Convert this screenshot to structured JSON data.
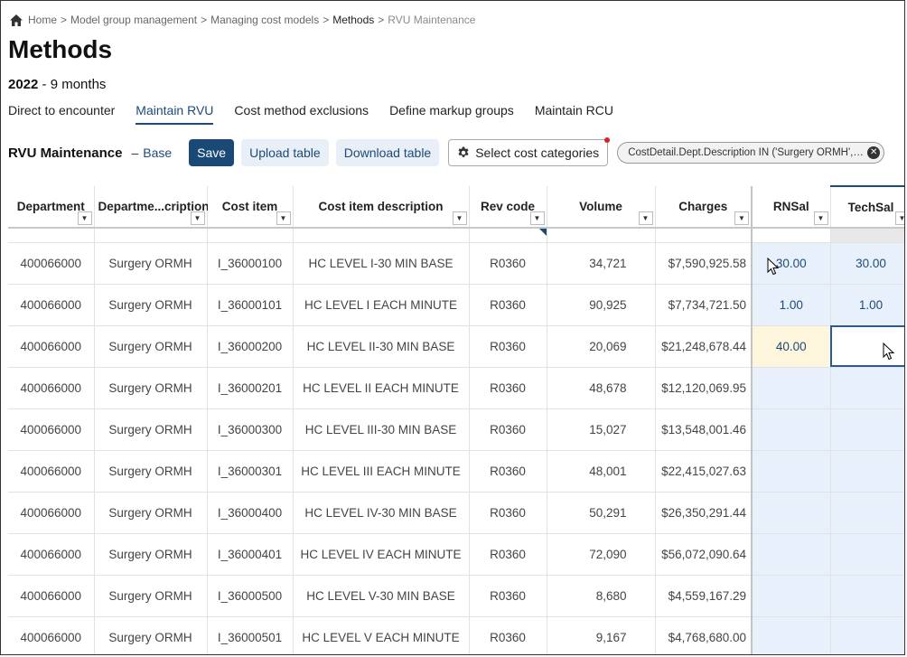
{
  "breadcrumb": {
    "home": "Home",
    "items": [
      "Model group management",
      "Managing cost models",
      "Methods",
      "RVU Maintenance"
    ]
  },
  "page": {
    "title": "Methods",
    "year": "2022",
    "period_suffix": "- 9 months"
  },
  "tabs": [
    {
      "label": "Direct to encounter",
      "active": false
    },
    {
      "label": "Maintain RVU",
      "active": true
    },
    {
      "label": "Cost method exclusions",
      "active": false
    },
    {
      "label": "Define markup groups",
      "active": false
    },
    {
      "label": "Maintain RCU",
      "active": false
    }
  ],
  "toolbar": {
    "title": "RVU Maintenance",
    "dash": "–",
    "base_label": "Base",
    "save_label": "Save",
    "upload_label": "Upload table",
    "download_label": "Download table",
    "select_categories_label": "Select cost categories",
    "filter_chip": "CostDetail.Dept.Description IN ('Surgery ORMH', 'S..."
  },
  "grid": {
    "columns": [
      "Department",
      "Departme...cription",
      "Cost item",
      "Cost item description",
      "Rev code",
      "Volume",
      "Charges",
      "RNSal",
      "TechSal"
    ],
    "rows": [
      {
        "department": "400066000",
        "dept_desc": "Surgery ORMH",
        "cost_item": "I_36000100",
        "item_desc": "HC LEVEL I-30 MIN BASE",
        "rev_code": "R0360",
        "volume": "34,721",
        "charges": "$7,590,925.58",
        "rnsal": "30.00",
        "techsal": "30.00"
      },
      {
        "department": "400066000",
        "dept_desc": "Surgery ORMH",
        "cost_item": "I_36000101",
        "item_desc": "HC LEVEL I EACH MINUTE",
        "rev_code": "R0360",
        "volume": "90,925",
        "charges": "$7,734,721.50",
        "rnsal": "1.00",
        "techsal": "1.00"
      },
      {
        "department": "400066000",
        "dept_desc": "Surgery ORMH",
        "cost_item": "I_36000200",
        "item_desc": "HC LEVEL II-30 MIN BASE",
        "rev_code": "R0360",
        "volume": "20,069",
        "charges": "$21,248,678.44",
        "rnsal": "40.00",
        "techsal": ""
      },
      {
        "department": "400066000",
        "dept_desc": "Surgery ORMH",
        "cost_item": "I_36000201",
        "item_desc": "HC LEVEL II EACH MINUTE",
        "rev_code": "R0360",
        "volume": "48,678",
        "charges": "$12,120,069.95",
        "rnsal": "",
        "techsal": ""
      },
      {
        "department": "400066000",
        "dept_desc": "Surgery ORMH",
        "cost_item": "I_36000300",
        "item_desc": "HC LEVEL III-30 MIN BASE",
        "rev_code": "R0360",
        "volume": "15,027",
        "charges": "$13,548,001.46",
        "rnsal": "",
        "techsal": ""
      },
      {
        "department": "400066000",
        "dept_desc": "Surgery ORMH",
        "cost_item": "I_36000301",
        "item_desc": "HC LEVEL III EACH MINUTE",
        "rev_code": "R0360",
        "volume": "48,001",
        "charges": "$22,415,027.63",
        "rnsal": "",
        "techsal": ""
      },
      {
        "department": "400066000",
        "dept_desc": "Surgery ORMH",
        "cost_item": "I_36000400",
        "item_desc": "HC LEVEL IV-30 MIN BASE",
        "rev_code": "R0360",
        "volume": "50,291",
        "charges": "$26,350,291.44",
        "rnsal": "",
        "techsal": ""
      },
      {
        "department": "400066000",
        "dept_desc": "Surgery ORMH",
        "cost_item": "I_36000401",
        "item_desc": "HC LEVEL IV EACH MINUTE",
        "rev_code": "R0360",
        "volume": "72,090",
        "charges": "$56,072,090.64",
        "rnsal": "",
        "techsal": ""
      },
      {
        "department": "400066000",
        "dept_desc": "Surgery ORMH",
        "cost_item": "I_36000500",
        "item_desc": "HC LEVEL V-30 MIN BASE",
        "rev_code": "R0360",
        "volume": "8,680",
        "charges": "$4,559,167.29",
        "rnsal": "",
        "techsal": ""
      },
      {
        "department": "400066000",
        "dept_desc": "Surgery ORMH",
        "cost_item": "I_36000501",
        "item_desc": "HC LEVEL V EACH MINUTE",
        "rev_code": "R0360",
        "volume": "9,167",
        "charges": "$4,768,680.00",
        "rnsal": "",
        "techsal": ""
      }
    ]
  },
  "colors": {
    "accent": "#1d4a78",
    "edit_cell": "#e8f0fb",
    "editing_cell": "#fdf5dc",
    "notify_dot": "#e02020"
  },
  "icons": [
    "home-icon",
    "gear-icon",
    "close-icon",
    "chevron-down-icon",
    "mouse-pointer-icon"
  ]
}
